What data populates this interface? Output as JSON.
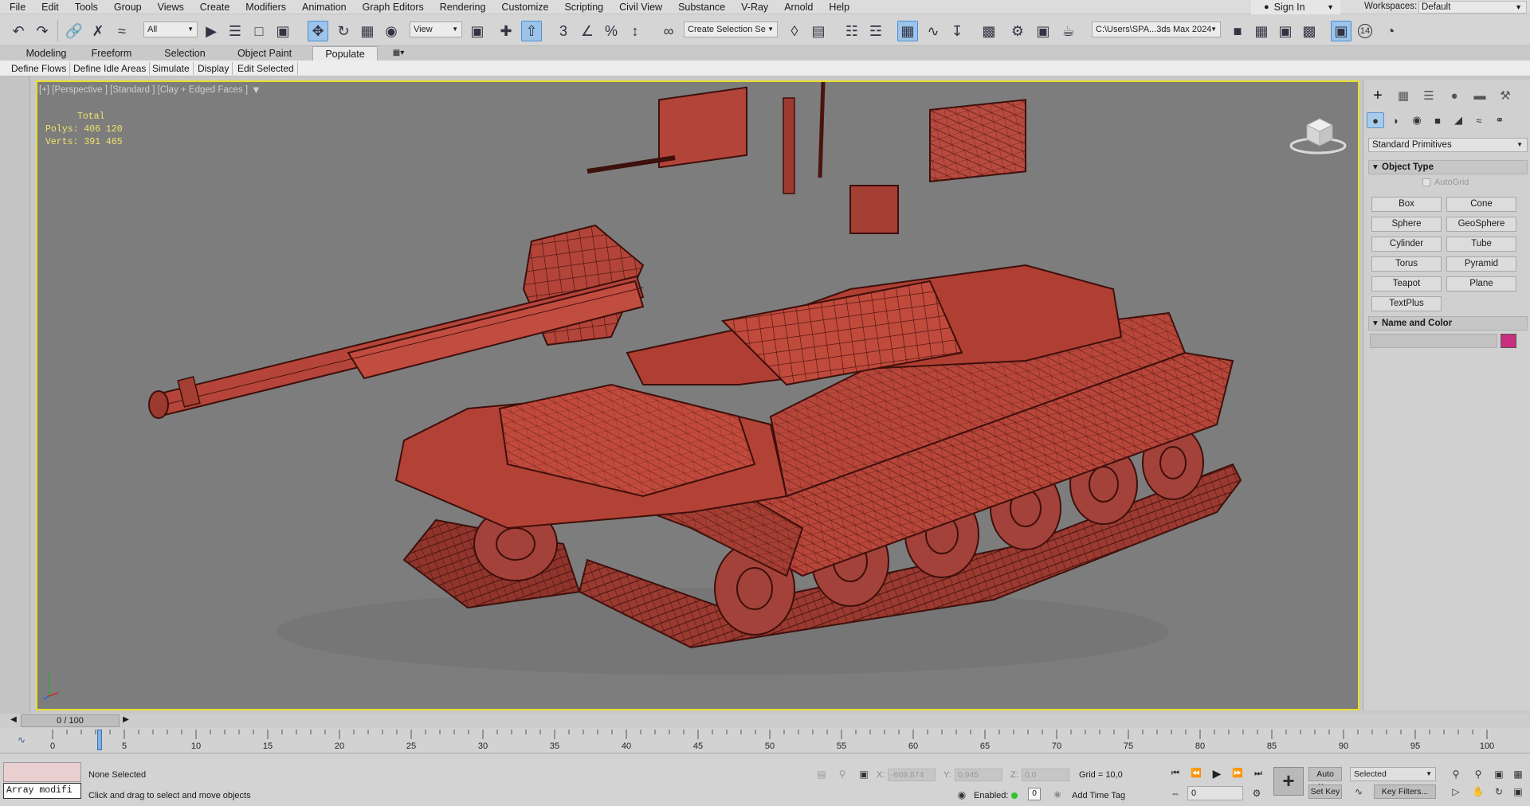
{
  "menubar": {
    "items": [
      "File",
      "Edit",
      "Tools",
      "Group",
      "Views",
      "Create",
      "Modifiers",
      "Animation",
      "Graph Editors",
      "Rendering",
      "Customize",
      "Scripting",
      "Civil View",
      "Substance",
      "V-Ray",
      "Arnold",
      "Help"
    ],
    "sign_in": "Sign In",
    "workspace_label": "Workspaces:",
    "workspace_value": "Default"
  },
  "toolbar": {
    "filter_value": "All",
    "refcoord_value": "View",
    "selection_set_value": "Create Selection Se",
    "project_path": "C:\\Users\\SPA...3ds Max 2024",
    "badge_14": "14"
  },
  "ribbon": {
    "tabs": [
      "Modeling",
      "Freeform",
      "Selection",
      "Object Paint",
      "Populate"
    ],
    "active_tab": "Populate",
    "subtabs": [
      "Define Flows",
      "Define Idle Areas",
      "Simulate",
      "Display",
      "Edit Selected"
    ]
  },
  "viewport": {
    "label": "[+] [Perspective ] [Standard ] [Clay + Edged Faces ]",
    "stats": {
      "title": "Total",
      "polys_label": "Polys:",
      "polys_value": "406 120",
      "verts_label": "Verts:",
      "verts_value": "391 465"
    },
    "model_color": "#b8463a",
    "wire_color": "#5a1a14"
  },
  "command_panel": {
    "category": "Standard Primitives",
    "object_type_title": "Object Type",
    "autogrid_label": "AutoGrid",
    "primitives": [
      "Box",
      "Cone",
      "Sphere",
      "GeoSphere",
      "Cylinder",
      "Tube",
      "Torus",
      "Pyramid",
      "Teapot",
      "Plane",
      "TextPlus"
    ],
    "name_color_title": "Name and Color",
    "object_color": "#c82f80"
  },
  "timeline": {
    "frame_display": "0 / 100",
    "ticks": [
      "0",
      "5",
      "10",
      "15",
      "20",
      "25",
      "30",
      "35",
      "40",
      "45",
      "50",
      "55",
      "60",
      "65",
      "70",
      "75",
      "80",
      "85",
      "90",
      "95",
      "100"
    ]
  },
  "status": {
    "maxscript_value": "Array modifi",
    "selection_status": "None Selected",
    "prompt": "Click and drag to select and move objects",
    "x_label": "X:",
    "x_value": "-609,874",
    "y_label": "Y:",
    "y_value": "0,945",
    "z_label": "Z:",
    "z_value": "0,0",
    "grid": "Grid = 10,0",
    "enabled_label": "Enabled:",
    "time_value": "0",
    "add_time_tag": "Add Time Tag",
    "auto_key": "Auto Key",
    "set_key": "Set Key",
    "key_mode_value": "Selected",
    "key_filters": "Key Filters...",
    "current_frame": "0"
  }
}
